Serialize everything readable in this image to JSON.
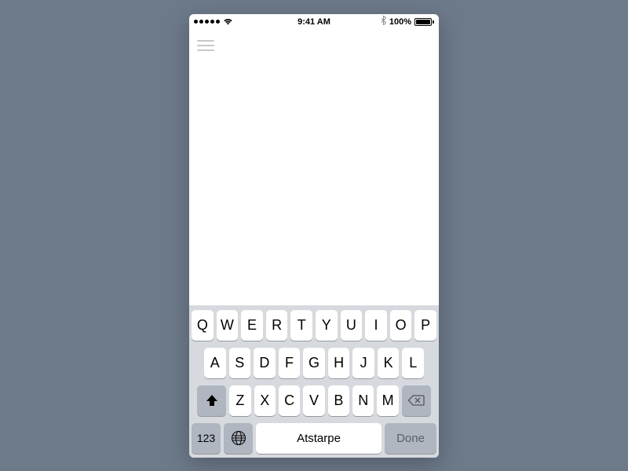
{
  "status": {
    "time": "9:41 AM",
    "battery_pct": "100%"
  },
  "keyboard": {
    "row1": [
      "Q",
      "W",
      "E",
      "R",
      "T",
      "Y",
      "U",
      "I",
      "O",
      "P"
    ],
    "row2": [
      "A",
      "S",
      "D",
      "F",
      "G",
      "H",
      "J",
      "K",
      "L"
    ],
    "row3": [
      "Z",
      "X",
      "C",
      "V",
      "B",
      "N",
      "M"
    ],
    "numbers_key": "123",
    "space_label": "Atstarpe",
    "done_label": "Done"
  }
}
